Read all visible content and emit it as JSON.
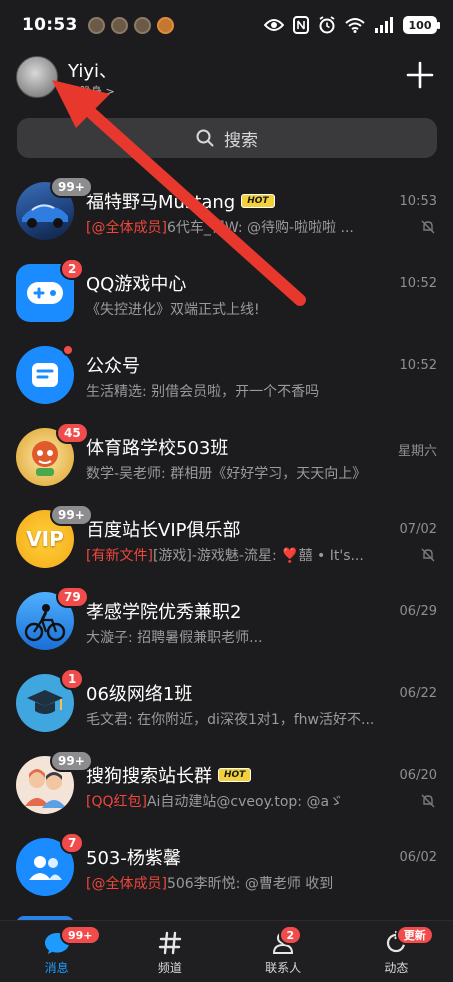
{
  "status_bar": {
    "time": "10:53",
    "battery": "100"
  },
  "header": {
    "username": "Yiyi、",
    "presence": "隐身 >"
  },
  "search": {
    "label": "搜索"
  },
  "chats": [
    {
      "name": "福特野马Mustang",
      "tag": "",
      "time": "10:53",
      "preview_highlight": "[@全体成员]",
      "preview": "6代车_罚W: @待购-啦啦啦 ...",
      "badge": "99+",
      "muted": true
    },
    {
      "name": "QQ游戏中心",
      "time": "10:52",
      "preview_highlight": "",
      "preview": "《失控进化》双端正式上线!",
      "badge": "2",
      "muted": false
    },
    {
      "name": "公众号",
      "time": "10:52",
      "preview_highlight": "",
      "preview": "生活精选: 别借会员啦，开一个不香吗",
      "badge": "",
      "muted": false
    },
    {
      "name": "体育路学校503班",
      "time": "星期六",
      "preview_highlight": "",
      "preview": "数学-吴老师: 群相册《好好学习，天天向上》",
      "badge": "45",
      "muted": false
    },
    {
      "name": "百度站长VIP俱乐部",
      "time": "07/02",
      "preview_highlight": "[有新文件]",
      "preview": "[游戏]-游戏魅-流星: ❣️囍 • It's...",
      "badge": "99+",
      "muted": true
    },
    {
      "name": "孝感学院优秀兼职2",
      "time": "06/29",
      "preview_highlight": "",
      "preview": "大漩子: 招聘暑假兼职老师...",
      "badge": "79",
      "muted": false
    },
    {
      "name": "06级网络1班",
      "time": "06/22",
      "preview_highlight": "",
      "preview": "毛文君: 在你附近，di深夜1对1，fhw活好不...",
      "badge": "1",
      "muted": false
    },
    {
      "name": "搜狗搜索站长群",
      "time": "06/20",
      "preview_highlight": "[QQ红包]",
      "preview": "Ai自动建站@cveoy.top: @aゞ",
      "badge": "99+",
      "muted": true
    },
    {
      "name": "503-杨紫馨",
      "time": "06/02",
      "preview_highlight": "[@全体成员]",
      "preview": "506李昕悦: @曹老师 收到",
      "badge": "7",
      "muted": false
    }
  ],
  "tab_bar": {
    "tabs": [
      {
        "label": "消息",
        "badge": "99+"
      },
      {
        "label": "频道",
        "badge": ""
      },
      {
        "label": "联系人",
        "badge": "2"
      },
      {
        "label": "动态",
        "badge": "更新"
      }
    ]
  },
  "colors": {
    "accent": "#1e9bff",
    "badge_red": "#f24b4b",
    "badge_gray": "#8d8d8f",
    "arrow_red": "#e8382d",
    "background": "#1c1c1e"
  }
}
